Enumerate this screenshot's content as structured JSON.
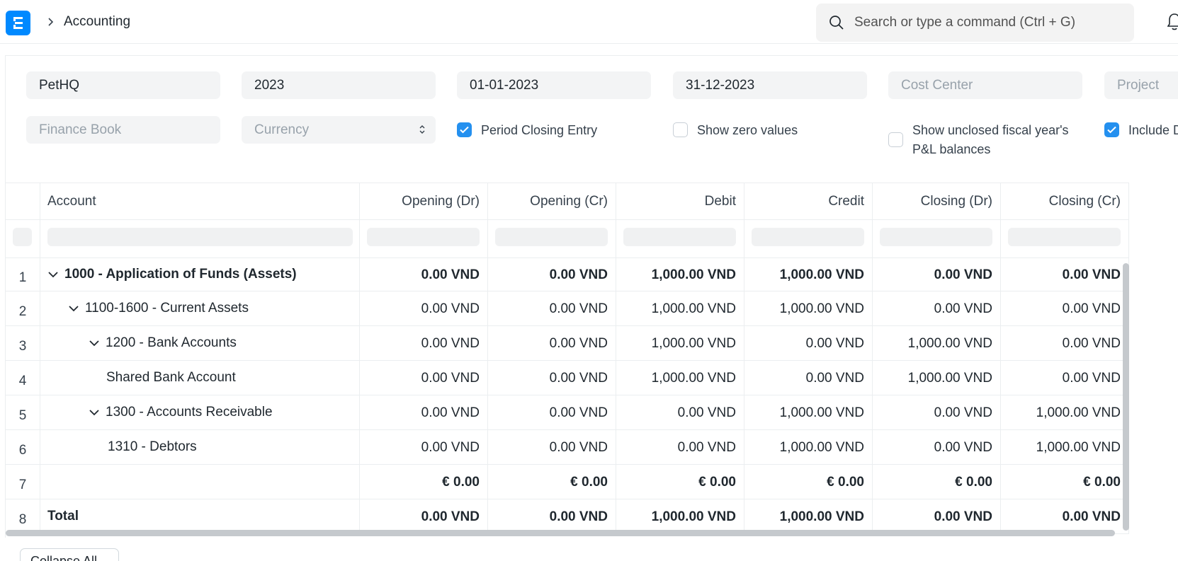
{
  "navbar": {
    "breadcrumb": "Accounting",
    "search_placeholder": "Search or type a command (Ctrl + G)"
  },
  "filters": {
    "company": "PetHQ",
    "fiscal_year": "2023",
    "from_date": "01-01-2023",
    "to_date": "31-12-2023",
    "cost_center_placeholder": "Cost Center",
    "project_placeholder": "Project",
    "finance_book_placeholder": "Finance Book",
    "currency_placeholder": "Currency",
    "period_closing_entry": "Period Closing Entry",
    "show_zero_values": "Show zero values",
    "show_unclosed_line1": "Show unclosed fiscal year's",
    "show_unclosed_line2": "P&L balances",
    "include_default": "Include D"
  },
  "table": {
    "columns": [
      "Account",
      "Opening (Dr)",
      "Opening (Cr)",
      "Debit",
      "Credit",
      "Closing (Dr)",
      "Closing (Cr)"
    ],
    "rows": [
      {
        "no": "1",
        "account": "1000 - Application of Funds (Assets)",
        "values": [
          "0.00 VND",
          "0.00 VND",
          "1,000.00 VND",
          "1,000.00 VND",
          "0.00 VND",
          "0.00 VND"
        ]
      },
      {
        "no": "2",
        "account": "1100-1600 - Current Assets",
        "values": [
          "0.00 VND",
          "0.00 VND",
          "1,000.00 VND",
          "1,000.00 VND",
          "0.00 VND",
          "0.00 VND"
        ]
      },
      {
        "no": "3",
        "account": "1200 - Bank Accounts",
        "values": [
          "0.00 VND",
          "0.00 VND",
          "1,000.00 VND",
          "0.00 VND",
          "1,000.00 VND",
          "0.00 VND"
        ]
      },
      {
        "no": "4",
        "account": "Shared Bank Account",
        "values": [
          "0.00 VND",
          "0.00 VND",
          "1,000.00 VND",
          "0.00 VND",
          "1,000.00 VND",
          "0.00 VND"
        ]
      },
      {
        "no": "5",
        "account": "1300 - Accounts Receivable",
        "values": [
          "0.00 VND",
          "0.00 VND",
          "0.00 VND",
          "1,000.00 VND",
          "0.00 VND",
          "1,000.00 VND"
        ]
      },
      {
        "no": "6",
        "account": "1310 - Debtors",
        "values": [
          "0.00 VND",
          "0.00 VND",
          "0.00 VND",
          "1,000.00 VND",
          "0.00 VND",
          "1,000.00 VND"
        ]
      },
      {
        "no": "7",
        "account": "",
        "values": [
          "€ 0.00",
          "€ 0.00",
          "€ 0.00",
          "€ 0.00",
          "€ 0.00",
          "€ 0.00"
        ]
      },
      {
        "no": "8",
        "account": "Total",
        "values": [
          "0.00 VND",
          "0.00 VND",
          "1,000.00 VND",
          "1,000.00 VND",
          "0.00 VND",
          "0.00 VND"
        ]
      }
    ]
  },
  "collapse_all": "Collapse All"
}
